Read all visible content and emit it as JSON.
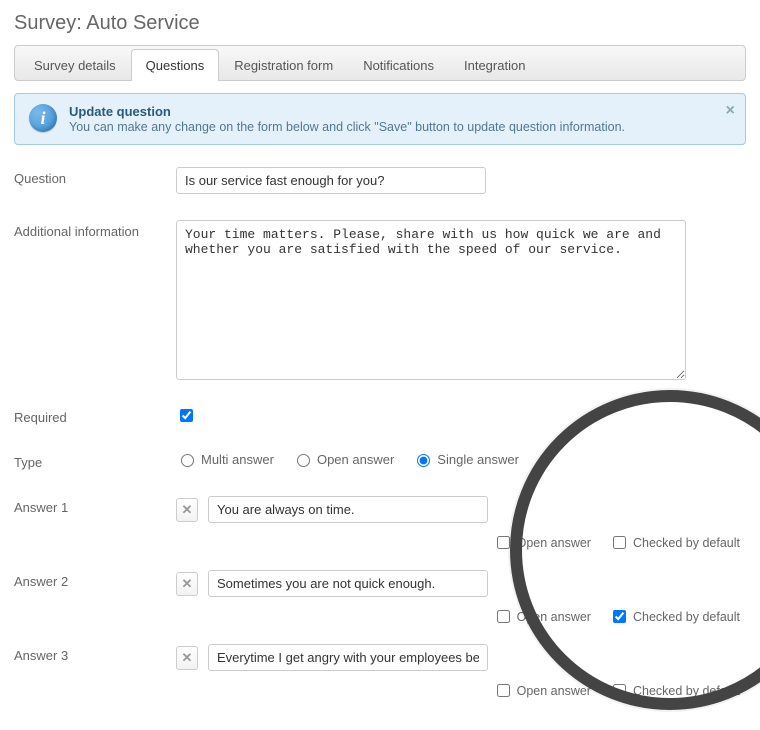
{
  "page": {
    "title": "Survey: Auto Service"
  },
  "tabs": {
    "details": "Survey details",
    "questions": "Questions",
    "registration": "Registration form",
    "notifications": "Notifications",
    "integration": "Integration"
  },
  "info": {
    "title": "Update question",
    "body": "You can make any change on the form below and click \"Save\" button to update question information."
  },
  "labels": {
    "question": "Question",
    "additional": "Additional information",
    "required": "Required",
    "type": "Type",
    "answer1": "Answer 1",
    "answer2": "Answer 2",
    "answer3": "Answer 3",
    "open_answer": "Open answer",
    "checked_default": "Checked by default",
    "multi": "Multi answer",
    "open": "Open answer",
    "single": "Single answer"
  },
  "fields": {
    "question_value": "Is our service fast enough for you?",
    "additional_value": "Your time matters. Please, share with us how quick we are and whether you are satisfied with the speed of our service.",
    "required_checked": true,
    "type_selected": "single"
  },
  "answers": [
    {
      "text": "You are always on time.",
      "open": false,
      "default": false
    },
    {
      "text": "Sometimes you are not quick enough.",
      "open": false,
      "default": true
    },
    {
      "text": "Everytime I get angry with your employees because they are slow.",
      "open": false,
      "default": false
    }
  ]
}
